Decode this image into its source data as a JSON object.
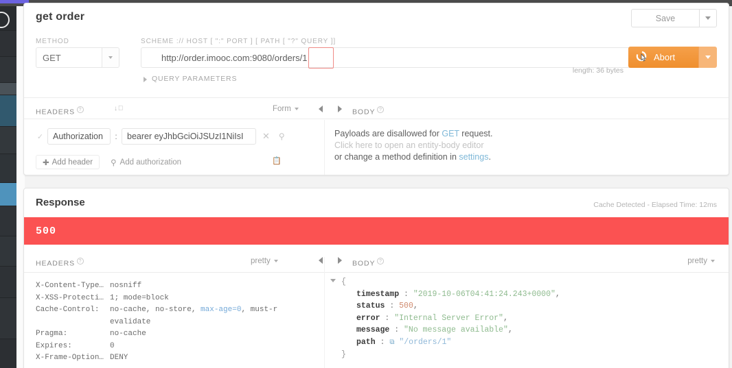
{
  "request": {
    "title": "get order",
    "save_label": "Save",
    "method_label": "METHOD",
    "method_value": "GET",
    "url_label": "SCHEME :// HOST [ \":\" PORT ] [ PATH [ \"?\" QUERY ]]",
    "url_value": "http://order.imooc.com:9080/orders/1",
    "url_highlight_text": "1",
    "length_note": "length: 36 bytes",
    "send_label": "Abort",
    "query_parameters_label": "QUERY PARAMETERS",
    "headers_label": "HEADERS",
    "body_label": "BODY",
    "form_dropdown": "Form",
    "header_rows": [
      {
        "enabled": "✓",
        "key": "Authorization",
        "separator": ":",
        "value": "bearer eyJhbGciOiJSUzI1NiIsI"
      }
    ],
    "add_header_label": "Add header",
    "add_authorization_label": "Add authorization",
    "body_line1_a": "Payloads are disallowed for ",
    "body_line1_link": "GET",
    "body_line1_b": " request.",
    "body_line2": "Click here to open an entity-body editor",
    "body_line3_a": "or change a method definition in ",
    "body_line3_link": "settings",
    "body_line3_b": "."
  },
  "response": {
    "title": "Response",
    "meta": "Cache Detected - Elapsed Time: 12ms",
    "status_code": "500",
    "status_color": "#fb5252",
    "headers_label": "HEADERS",
    "body_label": "BODY",
    "pretty_left": "pretty",
    "pretty_right": "pretty",
    "headers": [
      {
        "key": "X-Content-Type…",
        "value": "nosniff"
      },
      {
        "key": "X-XSS-Protecti…",
        "value": "1; mode=block"
      },
      {
        "key": "Cache-Control:",
        "value_a": "no-cache, no-store, ",
        "value_token": "max-age=0",
        "value_b": ", must-r",
        "value_cont": "evalidate"
      },
      {
        "key": "Pragma:",
        "value": "no-cache"
      },
      {
        "key": "Expires:",
        "value": "0"
      },
      {
        "key": "X-Frame-Option…",
        "value": "DENY"
      }
    ],
    "json": {
      "open_brace": "{",
      "close_brace": "}",
      "entries": [
        {
          "key": "timestamp",
          "value": "\"2019-10-06T04:41:24.243+0000\"",
          "type": "string",
          "comma": ","
        },
        {
          "key": "status",
          "value": "500",
          "type": "number",
          "comma": ","
        },
        {
          "key": "error",
          "value": "\"Internal Server Error\"",
          "type": "string",
          "comma": ","
        },
        {
          "key": "message",
          "value": "\"No message available\"",
          "type": "string",
          "comma": ","
        },
        {
          "key": "path",
          "value": "\"/orders/1\"",
          "type": "string",
          "comma": "",
          "link_icon": "⧉"
        }
      ]
    }
  }
}
